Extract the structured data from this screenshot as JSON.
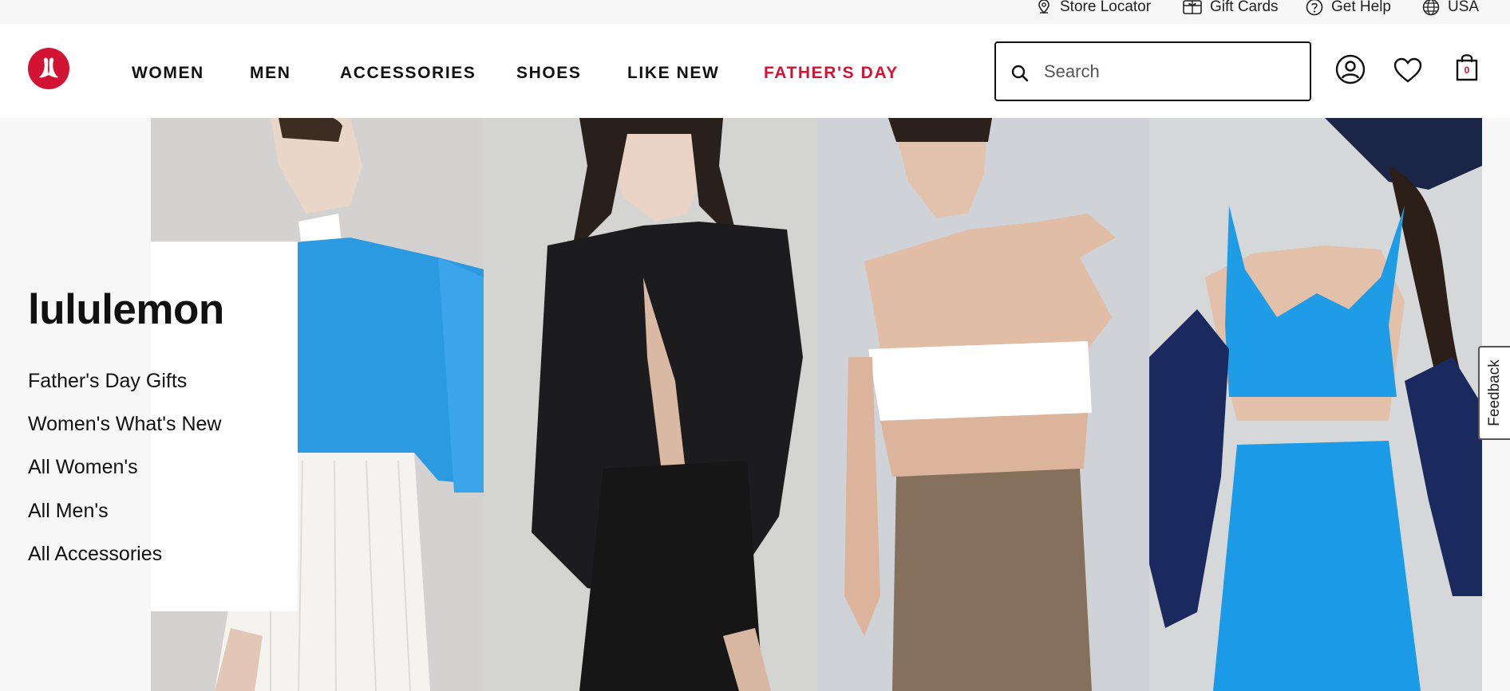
{
  "utility_bar": {
    "links": [
      {
        "label": "Store Locator",
        "icon": "map-pin-icon"
      },
      {
        "label": "Gift Cards",
        "icon": "gift-card-icon"
      },
      {
        "label": "Get Help",
        "icon": "help-circle-icon"
      },
      {
        "label": "USA",
        "icon": "globe-icon"
      }
    ]
  },
  "header": {
    "logo_icon": "lululemon-logo-icon",
    "nav": [
      {
        "label": "WOMEN"
      },
      {
        "label": "MEN"
      },
      {
        "label": "ACCESSORIES"
      },
      {
        "label": "SHOES"
      },
      {
        "label": "LIKE NEW"
      },
      {
        "label": "FATHER'S DAY",
        "accent": "#d31334"
      }
    ],
    "search": {
      "placeholder": "Search",
      "value": ""
    },
    "icons": [
      "account-icon",
      "wishlist-heart-icon",
      "shopping-bag-icon"
    ],
    "bag_count": "0"
  },
  "hero": {
    "panels": [
      {
        "description": "blue-sweater-white-skirt"
      },
      {
        "description": "black-shirt-black-skirt"
      },
      {
        "description": "white-bandeau-brown-skirt"
      },
      {
        "description": "blue-bra-blue-skirt"
      }
    ]
  },
  "content_card": {
    "title": "lululemon",
    "links": [
      "Father's Day Gifts",
      "Women's What's New",
      "All Women's",
      "All Men's",
      "All Accessories"
    ]
  },
  "feedback": {
    "label": "Feedback"
  },
  "colors": {
    "accent": "#d31334",
    "background": "#f7f7f7",
    "text": "#111111"
  }
}
